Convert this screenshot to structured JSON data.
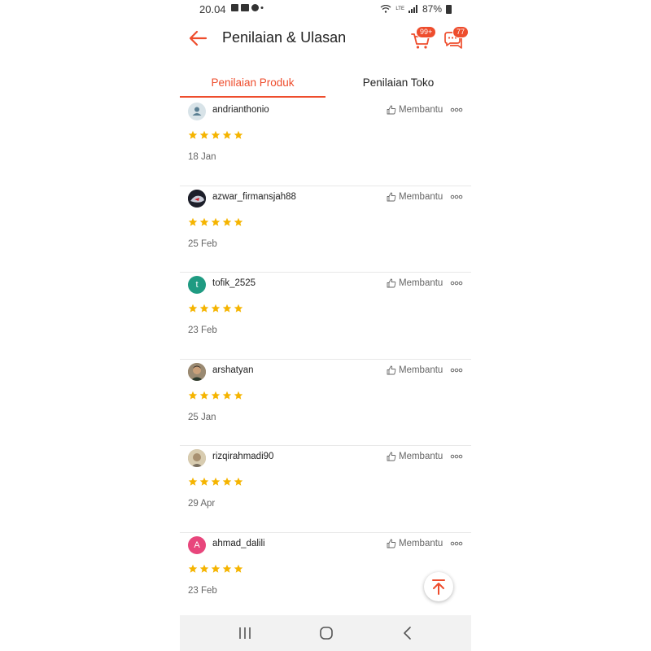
{
  "status_bar": {
    "time": "20.04",
    "battery": "87%",
    "network": "LTE"
  },
  "header": {
    "title": "Penilaian & Ulasan",
    "cart_badge": "99+",
    "chat_badge": "77"
  },
  "tabs": [
    {
      "label": "Penilaian Produk",
      "active": true
    },
    {
      "label": "Penilaian Toko",
      "active": false
    }
  ],
  "reviews": [
    {
      "username": "andrianthonio",
      "rating": 5,
      "date": "18 Jan",
      "helpful_label": "Membantu",
      "avatar": "default-user-icon"
    },
    {
      "username": "azwar_firmansjah88",
      "rating": 5,
      "date": "25 Feb",
      "helpful_label": "Membantu",
      "avatar": "photo"
    },
    {
      "username": "tofik_2525",
      "rating": 5,
      "date": "23 Feb",
      "helpful_label": "Membantu",
      "avatar_letter": "t",
      "avatar_color": "#1f9b82"
    },
    {
      "username": "arshatyan",
      "rating": 5,
      "date": "25 Jan",
      "helpful_label": "Membantu",
      "avatar": "photo"
    },
    {
      "username": "rizqirahmadi90",
      "rating": 5,
      "date": "29 Apr",
      "helpful_label": "Membantu",
      "avatar": "photo"
    },
    {
      "username": "ahmad_dalili",
      "rating": 5,
      "date": "23 Feb",
      "helpful_label": "Membantu",
      "avatar_letter": "A",
      "avatar_color": "#e8467c"
    }
  ],
  "colors": {
    "accent": "#ee4d2d",
    "star": "#f5b400"
  }
}
